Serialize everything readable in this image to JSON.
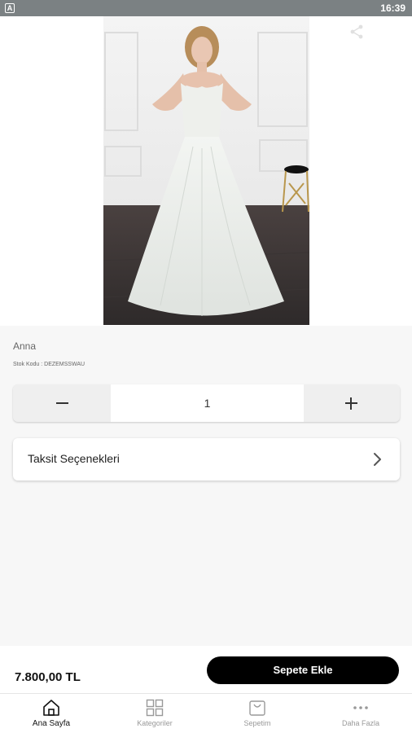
{
  "status_bar": {
    "badge": "A",
    "time": "16:39"
  },
  "product": {
    "name": "Anna",
    "sku": "Stok Kodu : DEZEMSSWAU",
    "quantity": "1",
    "installments_label": "Taksit Seçenekleri",
    "price": "7.800,00 TL"
  },
  "cart": {
    "add_label": "Sepete Ekle"
  },
  "nav": [
    {
      "label": "Ana Sayfa",
      "icon": "home-icon"
    },
    {
      "label": "Kategoriler",
      "icon": "grid-icon"
    },
    {
      "label": "Sepetim",
      "icon": "cart-icon"
    },
    {
      "label": "Daha Fazla",
      "icon": "more-icon"
    }
  ],
  "active_nav": "Ana Sayfa"
}
